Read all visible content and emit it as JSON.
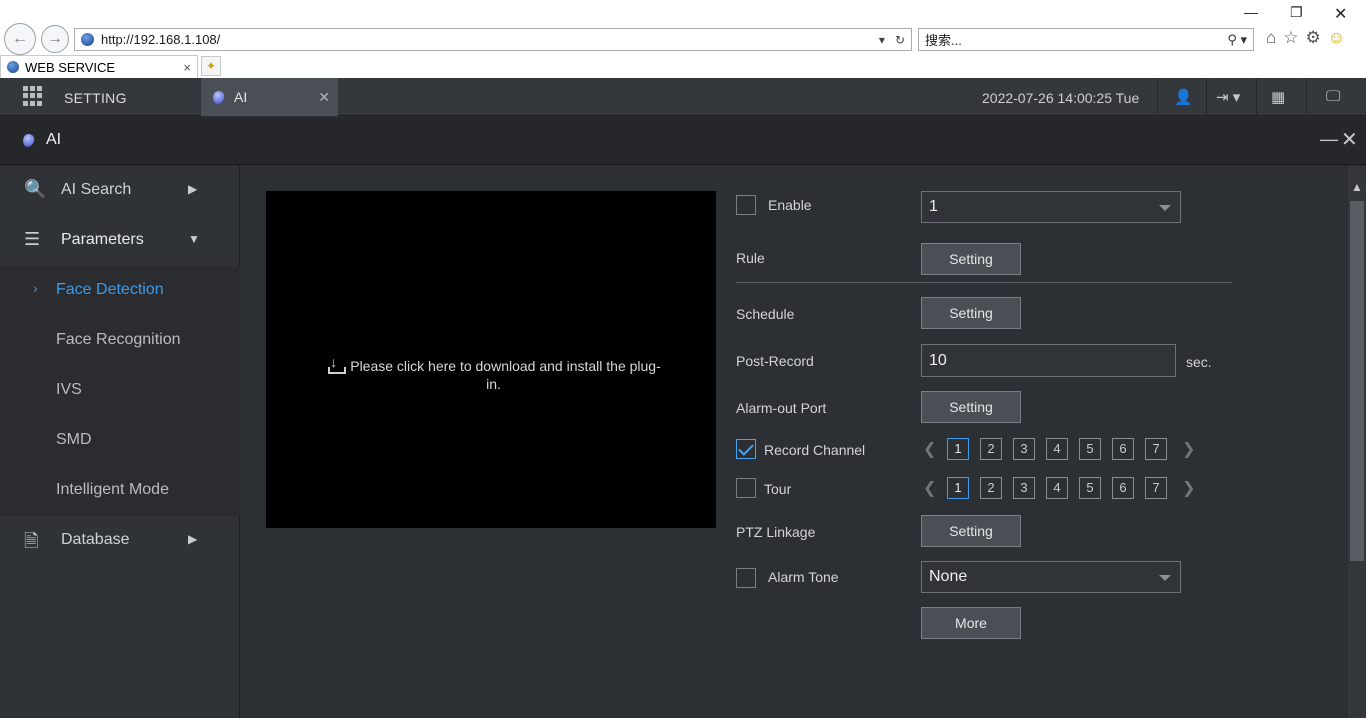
{
  "browser": {
    "url": "http://192.168.1.108/",
    "search_placeholder": "搜索...",
    "tab_title": "WEB SERVICE"
  },
  "topbar": {
    "setting_label": "SETTING",
    "tab_label": "AI",
    "datetime": "2022-07-26 14:00:25 Tue"
  },
  "panel": {
    "title": "AI"
  },
  "sidebar": {
    "ai_search": "AI Search",
    "parameters": "Parameters",
    "sub_items": [
      "Face Detection",
      "Face Recognition",
      "IVS",
      "SMD",
      "Intelligent Mode"
    ],
    "database": "Database"
  },
  "video": {
    "plugin_message": "Please click here to download and install the plug-in."
  },
  "form": {
    "enable_label": "Enable",
    "enable_checked": false,
    "channel_select": "1",
    "rule_label": "Rule",
    "schedule_label": "Schedule",
    "post_record_label": "Post-Record",
    "post_record_value": "10",
    "post_record_unit": "sec.",
    "alarm_out_label": "Alarm-out Port",
    "record_channel_label": "Record Channel",
    "record_channel_checked": true,
    "tour_label": "Tour",
    "tour_checked": false,
    "ptz_label": "PTZ Linkage",
    "alarm_tone_label": "Alarm Tone",
    "alarm_tone_value": "None",
    "setting_button": "Setting",
    "more_button": "More",
    "channels": [
      "1",
      "2",
      "3",
      "4",
      "5",
      "6",
      "7"
    ],
    "selected_channel": "1",
    "nav_prev": "❮",
    "nav_next": "❯"
  }
}
